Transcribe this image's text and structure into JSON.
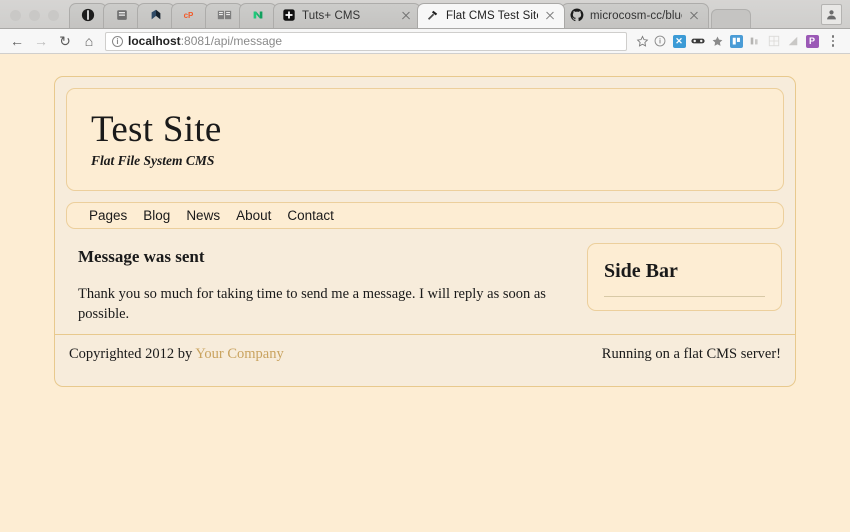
{
  "browser": {
    "tabs": [
      {
        "icon": "headphones-icon",
        "label": "",
        "named": false,
        "active": false
      },
      {
        "icon": "notebook-icon",
        "label": "",
        "named": false,
        "active": false
      },
      {
        "icon": "blue-shape-icon",
        "label": "",
        "named": false,
        "active": false
      },
      {
        "icon": "cpanel-icon",
        "label": "",
        "named": false,
        "active": false
      },
      {
        "icon": "dictionary-icon",
        "label": "",
        "named": false,
        "active": false
      },
      {
        "icon": "green-m-icon",
        "label": "",
        "named": false,
        "active": false
      },
      {
        "icon": "tutsplus-icon",
        "label": "Tuts+ CMS",
        "named": true,
        "active": false
      },
      {
        "icon": "hammer-icon",
        "label": "Flat CMS Test Site",
        "named": true,
        "active": true
      },
      {
        "icon": "github-icon",
        "label": "microcosm-cc/bluemonday:",
        "label_fade": "b",
        "named": true,
        "active": false
      }
    ],
    "toolbar": {
      "back_icon": "back-arrow-icon",
      "forward_icon": "forward-arrow-icon",
      "reload_icon": "reload-icon",
      "home_icon": "home-icon",
      "url_bold": "localhost",
      "url_rest": ":8081/api/message",
      "site_info_icon": "info-circle-icon",
      "bookmark_icon": "bookmark-star-icon",
      "extensions": [
        {
          "name": "info-extension-icon",
          "glyph": "ⓘ",
          "color": "#8a8a8a",
          "type": "glyph"
        },
        {
          "name": "xmarks-extension-icon",
          "glyph": "✕",
          "color": "#3c9bd6",
          "type": "square"
        },
        {
          "name": "goggles-extension-icon",
          "glyph": "●●",
          "color": "#3a3a3a",
          "type": "glyph"
        },
        {
          "name": "star-extension-icon",
          "glyph": "★",
          "color": "#8a8a8a",
          "type": "glyph"
        },
        {
          "name": "trello-extension-icon",
          "glyph": "▍▍",
          "color": "#4a9cd6",
          "type": "square"
        },
        {
          "name": "bars-extension-icon",
          "glyph": "▐▐",
          "color": "#b5b4b2",
          "type": "glyph"
        },
        {
          "name": "grid-extension-icon",
          "glyph": "▦",
          "color": "#dcdbd9",
          "type": "glyph"
        },
        {
          "name": "page-extension-icon",
          "glyph": "◥",
          "color": "#c9c8c6",
          "type": "glyph"
        },
        {
          "name": "pocket-extension-icon",
          "glyph": "P",
          "color": "#9b59b6",
          "type": "square"
        }
      ],
      "menu_icon": "kebab-menu-icon"
    },
    "profile_icon": "profile-avatar-icon"
  },
  "site": {
    "title": "Test Site",
    "tagline": "Flat File System CMS",
    "nav": [
      {
        "label": "Pages"
      },
      {
        "label": "Blog"
      },
      {
        "label": "News"
      },
      {
        "label": "About"
      },
      {
        "label": "Contact"
      }
    ],
    "main": {
      "heading": "Message was sent",
      "body": "Thank you so much for taking time to send me a message. I will reply as soon as possible."
    },
    "sidebar": {
      "title": "Side Bar"
    },
    "footer": {
      "copyright_text": "Copyrighted 2012 by",
      "company_link": "Your Company",
      "server_note": "Running on a flat CMS server!"
    },
    "colors": {
      "page_background": "#fdedd3",
      "wrapper_background": "#f7ecdb",
      "border": "#e8c98d",
      "link": "#c9a35f",
      "text": "#1a1a1a"
    }
  }
}
